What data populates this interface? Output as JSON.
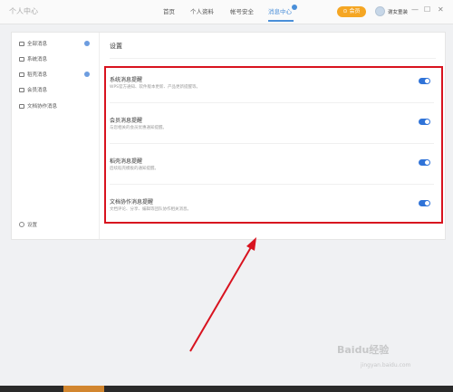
{
  "app": {
    "title": "个人中心"
  },
  "nav": {
    "items": [
      {
        "label": "首页",
        "active": false
      },
      {
        "label": "个人资料",
        "active": false
      },
      {
        "label": "帐号安全",
        "active": false
      },
      {
        "label": "消息中心",
        "active": true
      }
    ]
  },
  "header": {
    "vip_label": "⊙ 会员",
    "user_name": "谢女童装"
  },
  "window_controls": {
    "minimize": "—",
    "maximize": "☐",
    "close": "✕"
  },
  "sidebar": {
    "items": [
      {
        "label": "全部消息",
        "badge": true
      },
      {
        "label": "系统消息",
        "badge": false
      },
      {
        "label": "稻壳消息",
        "badge": true
      },
      {
        "label": "会员消息",
        "badge": false
      },
      {
        "label": "文档协作消息",
        "badge": false
      }
    ],
    "settings_label": "设置"
  },
  "main": {
    "title": "设置",
    "rows": [
      {
        "title": "系统消息提醒",
        "desc": "WPS官方通知、软件版本更新、产品更新提醒等。",
        "enabled": true
      },
      {
        "title": "会员消息提醒",
        "desc": "与您相关的会员优惠通知提醒。",
        "enabled": true
      },
      {
        "title": "稻壳消息提醒",
        "desc": "后续稻壳模板的通知提醒。",
        "enabled": true
      },
      {
        "title": "文档协作消息提醒",
        "desc": "文档评论、分享、编辑等团队协作相关消息。",
        "enabled": true
      }
    ]
  },
  "annotation": {
    "color": "#d8131f"
  },
  "watermark": {
    "text": "Baidu经验",
    "sub": "jingyan.baidu.com"
  }
}
